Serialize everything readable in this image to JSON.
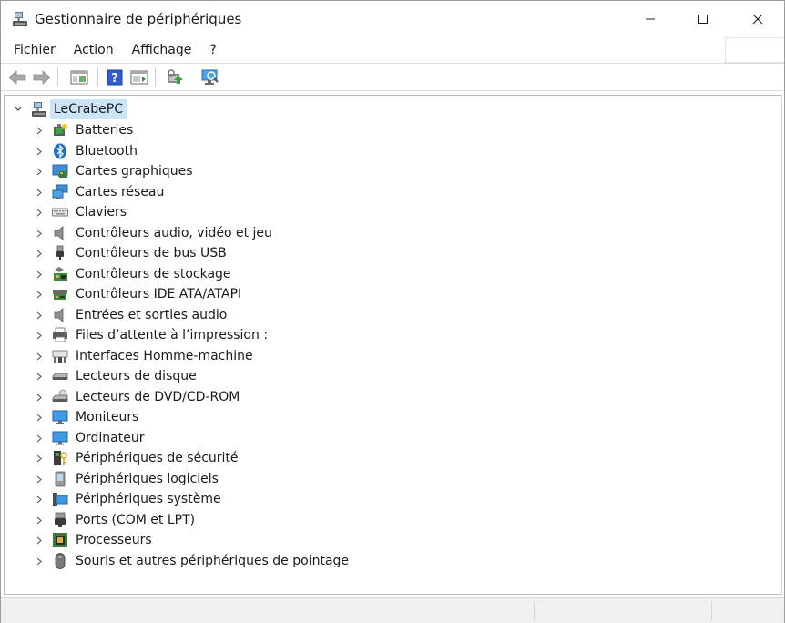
{
  "window": {
    "title": "Gestionnaire de périphériques"
  },
  "menu": {
    "items": [
      "Fichier",
      "Action",
      "Affichage",
      "?"
    ]
  },
  "toolbar": {
    "buttons": [
      "back-arrow-icon",
      "forward-arrow-icon",
      "show-hide-console-tree-icon",
      "help-icon",
      "properties-icon",
      "update-driver-icon",
      "scan-hardware-icon"
    ]
  },
  "tree": {
    "root": {
      "label": "LeCrabePC",
      "expanded": true,
      "icon": "computer-printer-icon"
    },
    "items": [
      {
        "label": "Batteries",
        "icon": "battery-icon"
      },
      {
        "label": "Bluetooth",
        "icon": "bluetooth-icon"
      },
      {
        "label": "Cartes graphiques",
        "icon": "display-adapter-icon"
      },
      {
        "label": "Cartes réseau",
        "icon": "network-adapter-icon"
      },
      {
        "label": "Claviers",
        "icon": "keyboard-icon"
      },
      {
        "label": "Contrôleurs audio, vidéo et jeu",
        "icon": "speaker-icon"
      },
      {
        "label": "Contrôleurs de bus USB",
        "icon": "usb-icon"
      },
      {
        "label": "Contrôleurs de stockage",
        "icon": "storage-controller-icon"
      },
      {
        "label": "Contrôleurs IDE ATA/ATAPI",
        "icon": "ide-controller-icon"
      },
      {
        "label": "Entrées et sorties audio",
        "icon": "audio-io-icon"
      },
      {
        "label": "Files d’attente à l’impression :",
        "icon": "print-queue-icon"
      },
      {
        "label": "Interfaces Homme-machine",
        "icon": "hid-icon"
      },
      {
        "label": "Lecteurs de disque",
        "icon": "disk-drive-icon"
      },
      {
        "label": "Lecteurs de DVD/CD-ROM",
        "icon": "dvd-drive-icon"
      },
      {
        "label": "Moniteurs",
        "icon": "monitor-icon"
      },
      {
        "label": "Ordinateur",
        "icon": "computer-icon"
      },
      {
        "label": "Périphériques de sécurité",
        "icon": "security-device-icon"
      },
      {
        "label": "Périphériques logiciels",
        "icon": "software-device-icon"
      },
      {
        "label": "Périphériques système",
        "icon": "system-device-icon"
      },
      {
        "label": "Ports (COM et LPT)",
        "icon": "port-icon"
      },
      {
        "label": "Processeurs",
        "icon": "processor-icon"
      },
      {
        "label": "Souris et autres périphériques de pointage",
        "icon": "mouse-icon"
      }
    ]
  },
  "colors": {
    "selection": "#cce4f7",
    "accent": "#0078d4"
  }
}
